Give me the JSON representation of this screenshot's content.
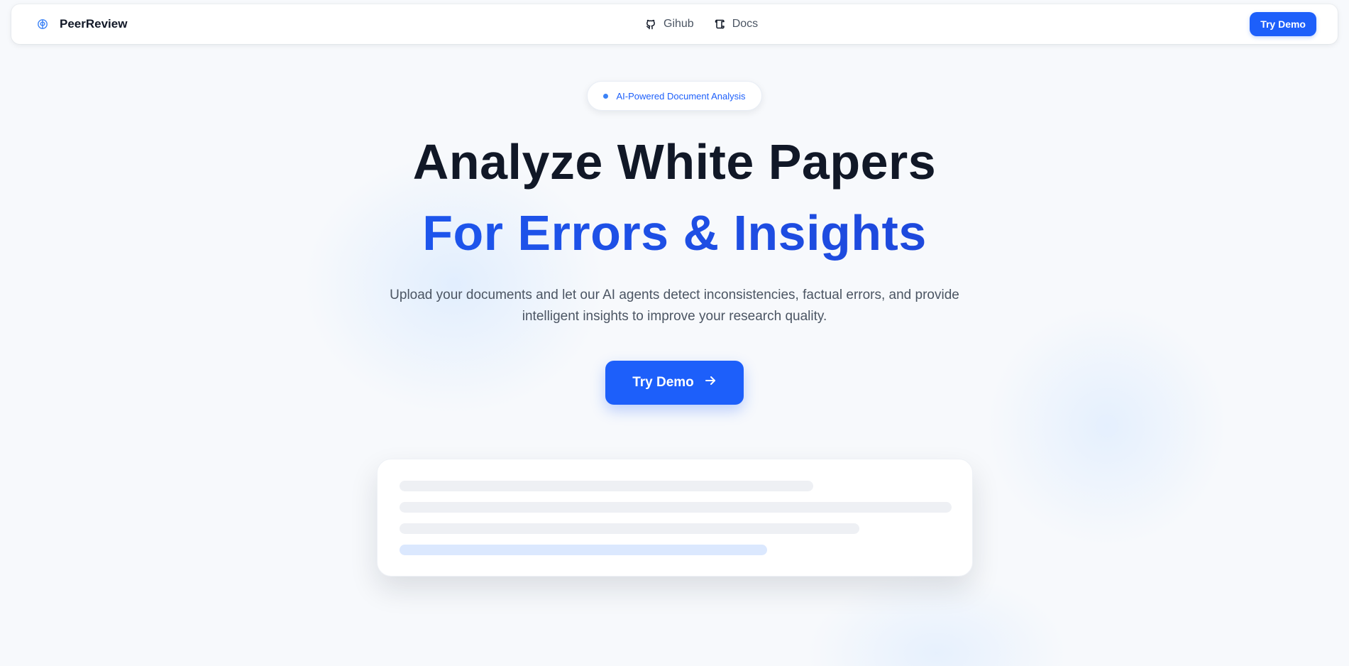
{
  "nav": {
    "brand": "PeerReview",
    "brand_icon": "brain-icon",
    "links": [
      {
        "label": "Gihub",
        "icon": "github-icon"
      },
      {
        "label": "Docs",
        "icon": "scroll-icon"
      }
    ],
    "cta_label": "Try Demo"
  },
  "hero": {
    "badge": "AI-Powered Document Analysis",
    "title_line1": "Analyze White Papers",
    "title_line2": "For Errors & Insights",
    "subtitle_line1": "Upload your documents and let our AI agents detect inconsistencies, factual errors, and provide",
    "subtitle_line2": "intelligent insights to improve your research quality.",
    "cta_label": "Try Demo",
    "cta_icon": "arrow-right-icon"
  },
  "colors": {
    "primary": "#1d5ffa",
    "heading": "#111827",
    "text_muted": "#4b5563",
    "skeleton": "#eef0f4",
    "skeleton_accent": "#dbe8fe"
  }
}
